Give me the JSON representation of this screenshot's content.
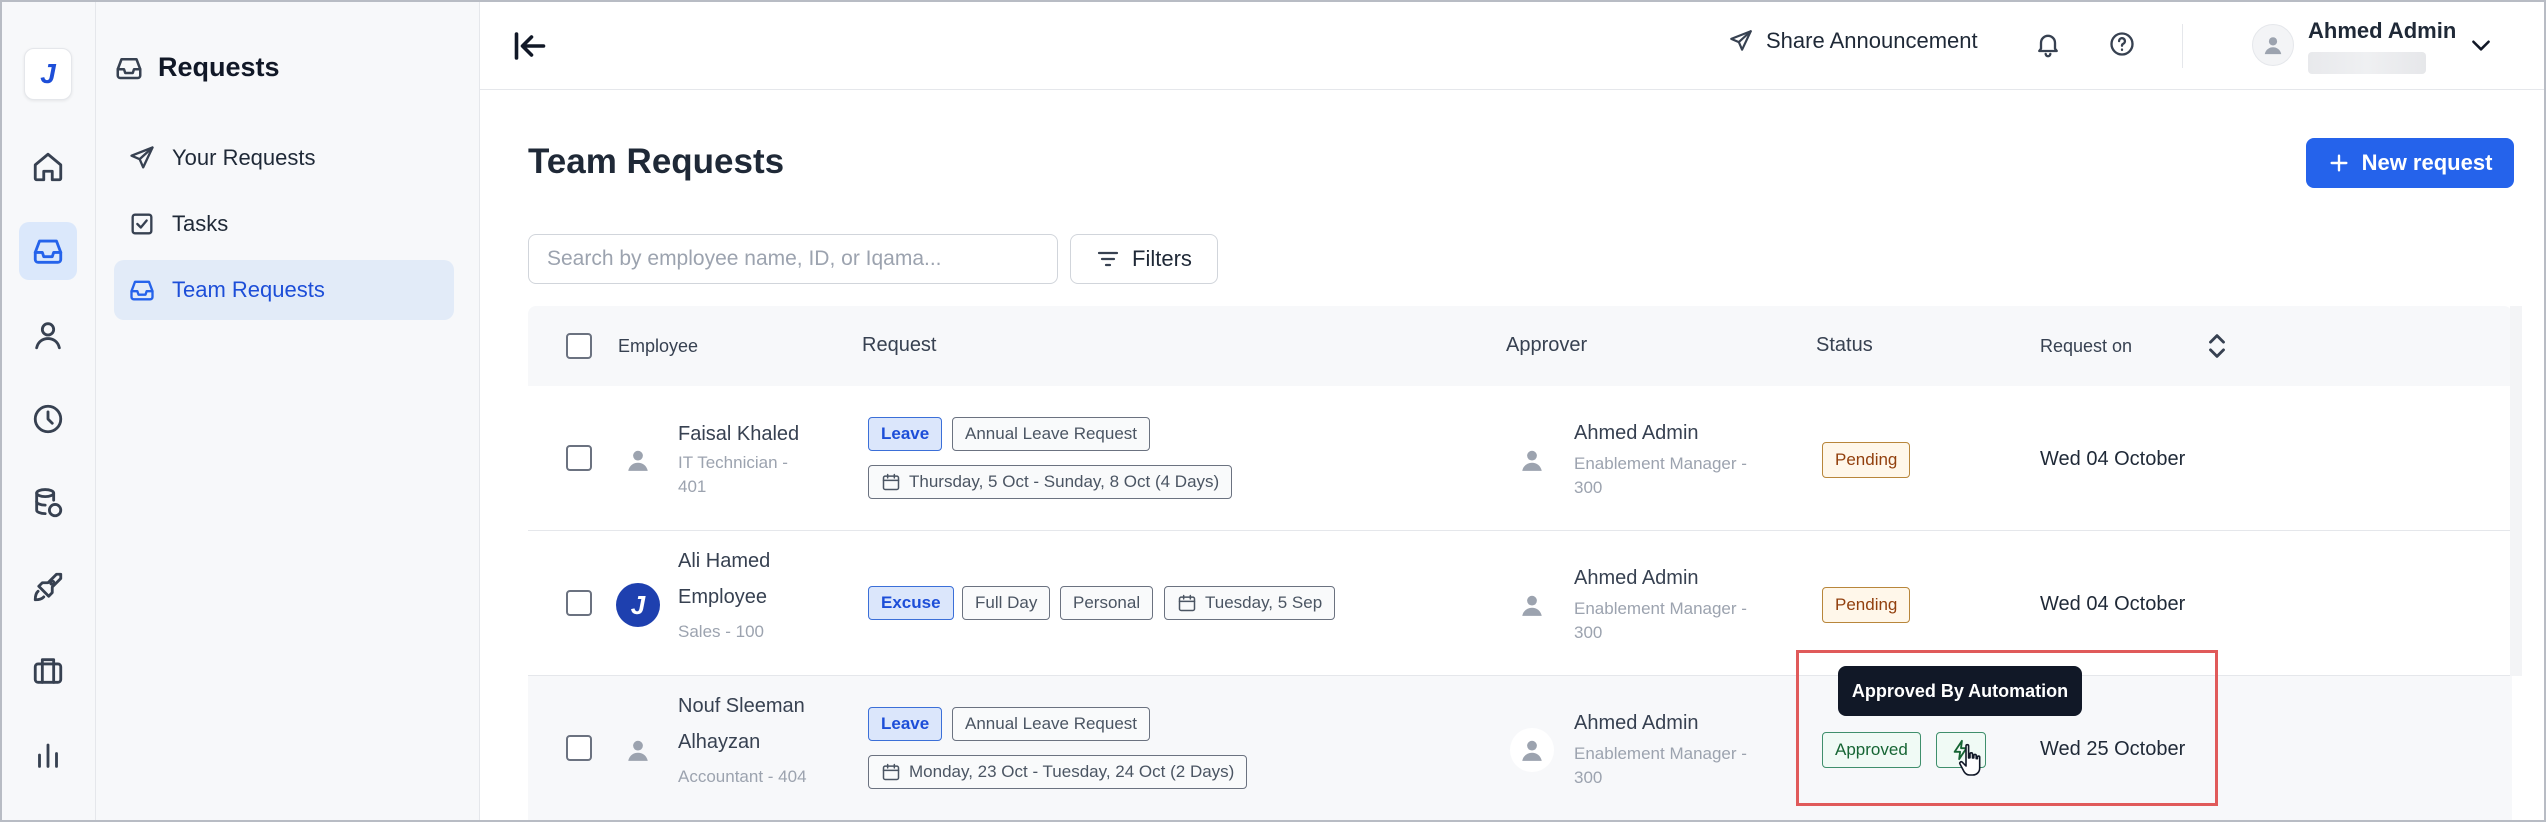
{
  "app": {
    "logo_letter": "J",
    "brand_color": "#2563eb"
  },
  "rail": {
    "items": [
      {
        "icon": "home-icon"
      },
      {
        "icon": "inbox-icon",
        "active": true
      },
      {
        "icon": "user-icon"
      },
      {
        "icon": "clock-icon"
      },
      {
        "icon": "database-icon"
      },
      {
        "icon": "rocket-icon"
      },
      {
        "icon": "briefcase-icon"
      },
      {
        "icon": "bar-chart-icon"
      }
    ]
  },
  "sidebar": {
    "title": "Requests",
    "items": [
      {
        "label": "Your Requests",
        "icon": "send-icon"
      },
      {
        "label": "Tasks",
        "icon": "check-square-icon"
      },
      {
        "label": "Team Requests",
        "icon": "inbox-icon",
        "active": true
      }
    ]
  },
  "topbar": {
    "share_label": "Share Announcement",
    "user_name": "Ahmed Admin"
  },
  "main": {
    "title": "Team Requests",
    "new_request_label": "New request",
    "search_placeholder": "Search by employee name, ID, or Iqama...",
    "filters_label": "Filters"
  },
  "table": {
    "columns": {
      "employee": "Employee",
      "request": "Request",
      "approver": "Approver",
      "status": "Status",
      "request_on": "Request on"
    },
    "rows": [
      {
        "employee_name": "Faisal Khaled",
        "employee_sub_1": "IT Technician -",
        "employee_sub_2": "401",
        "type": "Leave",
        "detail": "Annual Leave Request",
        "date_range": "Thursday, 5 Oct - Sunday, 8 Oct (4 Days)",
        "approver_name": "Ahmed Admin",
        "approver_sub_1": "Enablement Manager -",
        "approver_sub_2": "300",
        "status": "Pending",
        "request_on": "Wed 04 October"
      },
      {
        "employee_name_1": "Ali Hamed",
        "employee_name_2": "Employee",
        "employee_sub_1": "Sales - 100",
        "avatar_letter": "J",
        "type": "Excuse",
        "tag_1": "Full Day",
        "tag_2": "Personal",
        "date_range": "Tuesday, 5 Sep",
        "approver_name": "Ahmed Admin",
        "approver_sub_1": "Enablement Manager -",
        "approver_sub_2": "300",
        "status": "Pending",
        "request_on": "Wed 04 October"
      },
      {
        "employee_name_1": "Nouf Sleeman",
        "employee_name_2": "Alhayzan",
        "employee_sub_1": "Accountant - 404",
        "type": "Leave",
        "detail": "Annual Leave Request",
        "date_range": "Monday, 23 Oct - Tuesday, 24 Oct (2 Days)",
        "approver_name": "Ahmed Admin",
        "approver_sub_1": "Enablement Manager -",
        "approver_sub_2": "300",
        "status": "Approved",
        "request_on": "Wed 25 October"
      }
    ]
  },
  "tooltip": {
    "text": "Approved By Automation"
  }
}
